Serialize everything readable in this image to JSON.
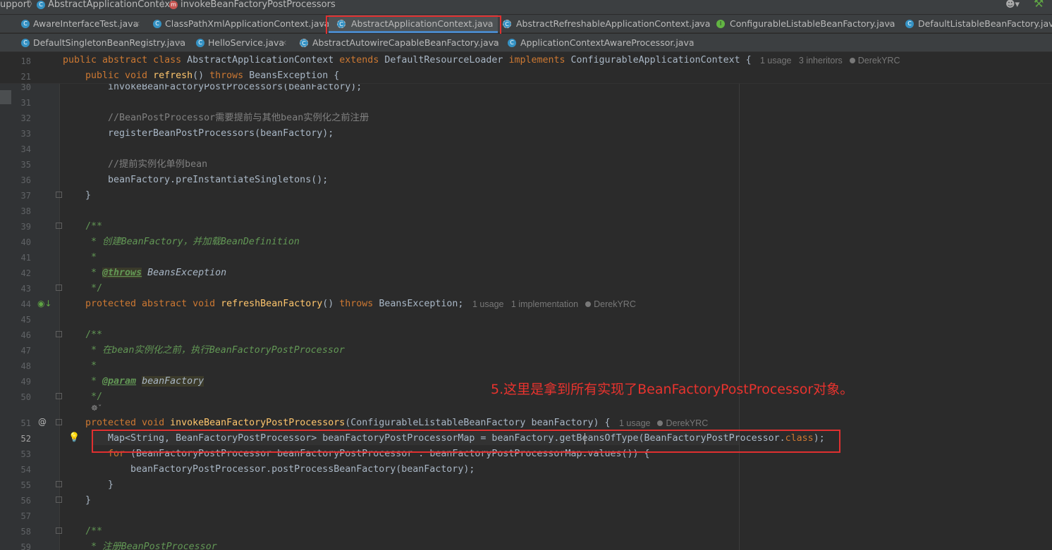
{
  "breadcrumb": {
    "items": [
      "upport",
      "AbstractApplicationContext",
      "invokeBeanFactoryPostProcessors"
    ],
    "separator": "〉",
    "method_badge": "m"
  },
  "tabs_row1": [
    {
      "label": "AwareInterfaceTest.java",
      "icon": "class-run-icon",
      "close": "×"
    },
    {
      "label": "ClassPathXmlApplicationContext.java",
      "icon": "class-icon",
      "close": "×"
    },
    {
      "label": "AbstractApplicationContext.java",
      "icon": "abstract-class-icon",
      "close": "×",
      "active": true
    },
    {
      "label": "AbstractRefreshableApplicationContext.java",
      "icon": "abstract-class-icon",
      "close": "×"
    },
    {
      "label": "ConfigurableListableBeanFactory.java",
      "icon": "interface-icon",
      "close": "×"
    },
    {
      "label": "DefaultListableBeanFactory.java",
      "icon": "class-icon",
      "close": ""
    }
  ],
  "tabs_row2": [
    {
      "label": "DefaultSingletonBeanRegistry.java",
      "icon": "class-icon",
      "close": "×"
    },
    {
      "label": "HelloService.java",
      "icon": "class-icon",
      "close": "×"
    },
    {
      "label": "AbstractAutowireCapableBeanFactory.java",
      "icon": "abstract-class-icon",
      "close": "×"
    },
    {
      "label": "ApplicationContextAwareProcessor.java",
      "icon": "class-icon",
      "close": "×"
    }
  ],
  "icons": {
    "class": "C",
    "interface": "I"
  },
  "sticky": {
    "line18": {
      "num": "18",
      "kw1": "public abstract class ",
      "name": "AbstractApplicationContext ",
      "kw2": "extends ",
      "parent": "DefaultResourceLoader ",
      "kw3": "implements ",
      "iface": "ConfigurableApplicationContext { ",
      "hint_usage": "1 usage",
      "hint_inheritors": "3 inheritors",
      "hint_author": "DerekYRC"
    },
    "line21": {
      "num": "21",
      "kw1": "public void ",
      "fn": "refresh",
      "paren": "() ",
      "kw2": "throws ",
      "rest": "BeansException {"
    }
  },
  "lines": {
    "l30": {
      "num": "30",
      "text": "invokeBeanFactoryPostProcessors(beanFactory);"
    },
    "l31": {
      "num": "31"
    },
    "l32": {
      "num": "32",
      "text": "//BeanPostProcessor需要提前与其他bean实例化之前注册"
    },
    "l33": {
      "num": "33",
      "text": "registerBeanPostProcessors(beanFactory);"
    },
    "l34": {
      "num": "34"
    },
    "l35": {
      "num": "35",
      "text": "//提前实例化单例bean"
    },
    "l36": {
      "num": "36",
      "text": "beanFactory.preInstantiateSingletons();"
    },
    "l37": {
      "num": "37",
      "text": "}"
    },
    "l38": {
      "num": "38"
    },
    "l39": {
      "num": "39",
      "text": "/**"
    },
    "l40": {
      "num": "40",
      "text": " * 创建BeanFactory，并加载BeanDefinition"
    },
    "l41": {
      "num": "41",
      "text": " *"
    },
    "l42": {
      "num": "42",
      "star": " * ",
      "tag": "@throws",
      "rest": " BeansException"
    },
    "l43": {
      "num": "43",
      "text": " */"
    },
    "l44": {
      "num": "44",
      "kw1": "protected abstract void ",
      "fn": "refreshBeanFactory",
      "paren": "() ",
      "kw2": "throws ",
      "rest": "BeansException;",
      "hint_usage": "1 usage",
      "hint_impl": "1 implementation",
      "hint_author": "DerekYRC"
    },
    "l45": {
      "num": "45"
    },
    "l46": {
      "num": "46",
      "text": "/**"
    },
    "l47": {
      "num": "47",
      "text": " * 在bean实例化之前，执行BeanFactoryPostProcessor"
    },
    "l48": {
      "num": "48",
      "text": " *"
    },
    "l49": {
      "num": "49",
      "star": " * ",
      "tag": "@param",
      "param": "beanFactory"
    },
    "l50": {
      "num": "50",
      "text": " */"
    },
    "l51": {
      "num": "51",
      "kw1": "protected void ",
      "fn": "invokeBeanFactoryPostProcessors",
      "rest": "(ConfigurableListableBeanFactory beanFactory) { ",
      "hint_usage": "1 usage",
      "hint_author": "DerekYRC"
    },
    "l52": {
      "num": "52",
      "text": "Map<String, BeanFactoryPostProcessor> beanFactoryPostProcessorMap = beanFactory.getBeansOfType(BeanFactoryPostProcessor.",
      "kwclass": "class",
      "end": ");"
    },
    "l53": {
      "num": "53",
      "kw": "for ",
      "text": "(BeanFactoryPostProcessor beanFactoryPostProcessor : beanFactoryPostProcessorMap.values()) {"
    },
    "l54": {
      "num": "54",
      "text": "beanFactoryPostProcessor.postProcessBeanFactory(beanFactory);"
    },
    "l55": {
      "num": "55",
      "text": "}"
    },
    "l56": {
      "num": "56",
      "text": "}"
    },
    "l57": {
      "num": "57"
    },
    "l58": {
      "num": "58",
      "text": "/**"
    },
    "l59": {
      "num": "59",
      "text": " * 注册BeanPostProcessor"
    }
  },
  "annotation": "5.这里是拿到所有实现了BeanFactoryPostProcessor对象。",
  "colors": {
    "keyword": "#cc7832",
    "function": "#ffc66d",
    "doc": "#629755",
    "annotation": "#e8332e",
    "highlight_box": "#e03030"
  }
}
